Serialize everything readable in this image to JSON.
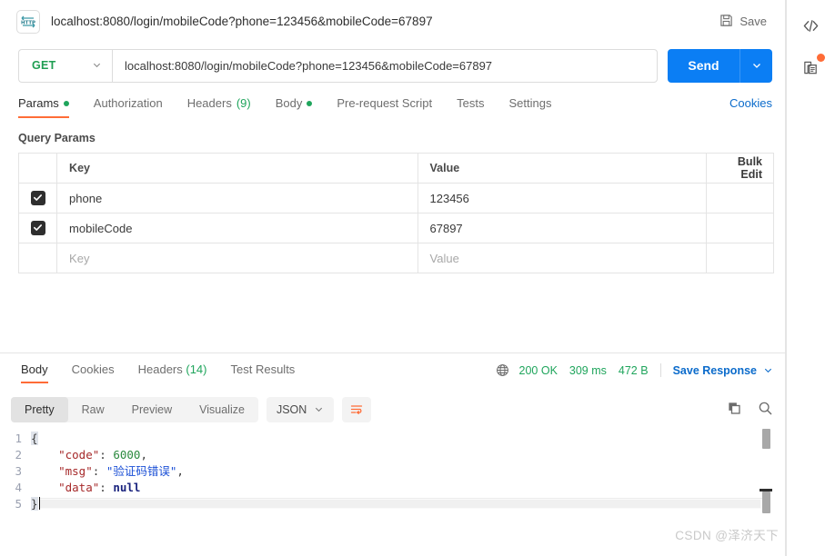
{
  "request": {
    "protocol_icon": "http-badge-icon",
    "title": "localhost:8080/login/mobileCode?phone=123456&mobileCode=67897",
    "save_label": "Save",
    "save_icon": "floppy-disk-icon",
    "method": "GET",
    "method_caret_icon": "chevron-down-icon",
    "url": "localhost:8080/login/mobileCode?phone=123456&mobileCode=67897",
    "send_label": "Send",
    "send_caret_icon": "chevron-down-icon"
  },
  "request_tabs": [
    {
      "label": "Params",
      "dot": true,
      "active": true
    },
    {
      "label": "Authorization",
      "dot": false,
      "active": false
    },
    {
      "label": "Headers",
      "count": "(9)",
      "dot": false,
      "active": false
    },
    {
      "label": "Body",
      "dot": true,
      "active": false
    },
    {
      "label": "Pre-request Script",
      "dot": false,
      "active": false
    },
    {
      "label": "Tests",
      "dot": false,
      "active": false
    },
    {
      "label": "Settings",
      "dot": false,
      "active": false
    }
  ],
  "cookies_link": "Cookies",
  "query_params": {
    "section_label": "Query Params",
    "headers": {
      "key": "Key",
      "value": "Value",
      "bulk_edit": "Bulk Edit"
    },
    "rows": [
      {
        "checked": true,
        "key": "phone",
        "value": "123456",
        "placeholder": false
      },
      {
        "checked": true,
        "key": "mobileCode",
        "value": "67897",
        "placeholder": false
      },
      {
        "checked": false,
        "key": "Key",
        "value": "Value",
        "placeholder": true
      }
    ]
  },
  "response": {
    "tabs": [
      {
        "label": "Body",
        "active": true
      },
      {
        "label": "Cookies",
        "active": false
      },
      {
        "label": "Headers",
        "count": "(14)",
        "active": false
      },
      {
        "label": "Test Results",
        "active": false
      }
    ],
    "globe_icon": "globe-icon",
    "status": "200 OK",
    "time": "309 ms",
    "size": "472 B",
    "save_response_label": "Save Response",
    "save_response_caret_icon": "chevron-down-icon",
    "view_modes": [
      {
        "label": "Pretty",
        "active": true
      },
      {
        "label": "Raw",
        "active": false
      },
      {
        "label": "Preview",
        "active": false
      },
      {
        "label": "Visualize",
        "active": false
      }
    ],
    "format": "JSON",
    "format_caret_icon": "chevron-down-icon",
    "wrap_icon": "wrap-lines-icon",
    "copy_icon": "copy-icon",
    "search_icon": "search-icon",
    "body_lines": [
      "1",
      "2",
      "3",
      "4",
      "5"
    ],
    "body": {
      "line1": "{",
      "line2_key": "\"code\"",
      "line2_val": "6000",
      "line3_key": "\"msg\"",
      "line3_val": "\"验证码错误\"",
      "line4_key": "\"data\"",
      "line4_val": "null",
      "line5": "}",
      "colon": ": ",
      "comma": ","
    }
  },
  "right_rail": {
    "code_icon": "code-snippet-icon",
    "docs_icon": "documentation-icon",
    "docs_badge": true
  },
  "watermark": "CSDN @泽济天下",
  "colors": {
    "accent_orange": "#ff6c37",
    "send_blue": "#0b7ef4",
    "link_blue": "#0b6bcb",
    "status_green": "#1fa55c",
    "method_green": "#1f9e52"
  }
}
